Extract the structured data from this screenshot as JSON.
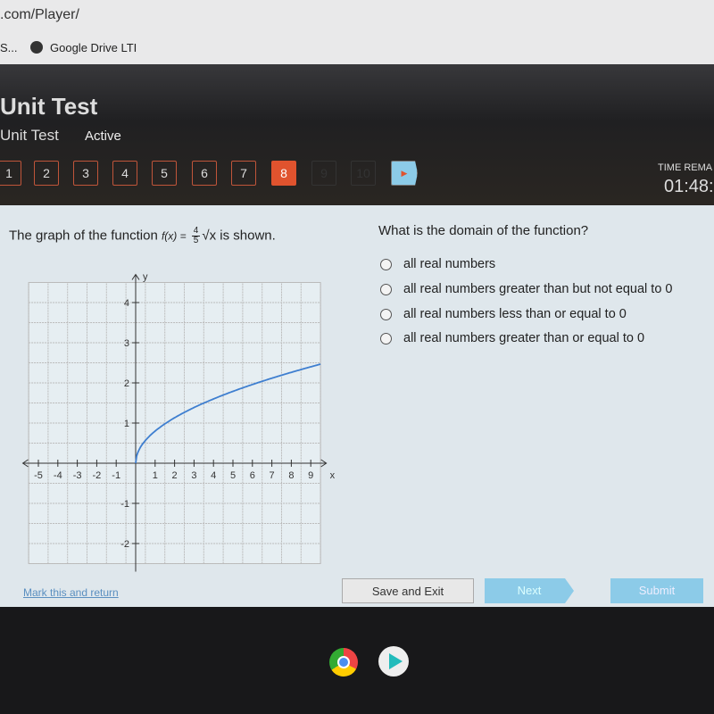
{
  "browser": {
    "url": ".com/Player/",
    "bookmarks": [
      "S...",
      "Google Drive LTI"
    ]
  },
  "header": {
    "title_cropped": "Unit Test",
    "subtitle": "Unit Test",
    "status": "Active",
    "time_label": "TIME REMA",
    "time_value": "01:48:"
  },
  "questions": {
    "items": [
      "1",
      "2",
      "3",
      "4",
      "5",
      "6",
      "7",
      "8",
      "9",
      "10"
    ],
    "current": "8",
    "next_icon": "play-arrow-icon"
  },
  "question": {
    "prefix": "The graph of the function",
    "func": "f(x) =",
    "num": "4",
    "den": "5",
    "sqrt": "√x",
    "suffix": "is shown.",
    "prompt": "What is the domain of the function?",
    "options": [
      "all real numbers",
      "all real numbers greater than but not equal to 0",
      "all real numbers less than or equal to 0",
      "all real numbers greater than or equal to 0"
    ]
  },
  "chart_data": {
    "type": "line",
    "function": "f(x) = (4/5)√x",
    "xlabel": "x",
    "ylabel": "y",
    "xlim": [
      -5.5,
      9.5
    ],
    "ylim": [
      -2.5,
      4.5
    ],
    "xticks": [
      -5,
      -4,
      -3,
      -2,
      -1,
      1,
      2,
      3,
      4,
      5,
      6,
      7,
      8,
      9
    ],
    "yticks": [
      -2,
      -1,
      1,
      2,
      3,
      4
    ],
    "grid": true,
    "series": [
      {
        "x": [
          0,
          0.25,
          1,
          2,
          3,
          4,
          5,
          6,
          7,
          8,
          9,
          9.5
        ],
        "y": [
          0,
          0.4,
          0.8,
          1.13,
          1.39,
          1.6,
          1.79,
          1.96,
          2.12,
          2.26,
          2.4,
          2.47
        ]
      }
    ],
    "color": "#3f7fd0"
  },
  "footer": {
    "mark": "Mark this and return",
    "save": "Save and Exit",
    "next": "Next",
    "submit": "Submit"
  }
}
